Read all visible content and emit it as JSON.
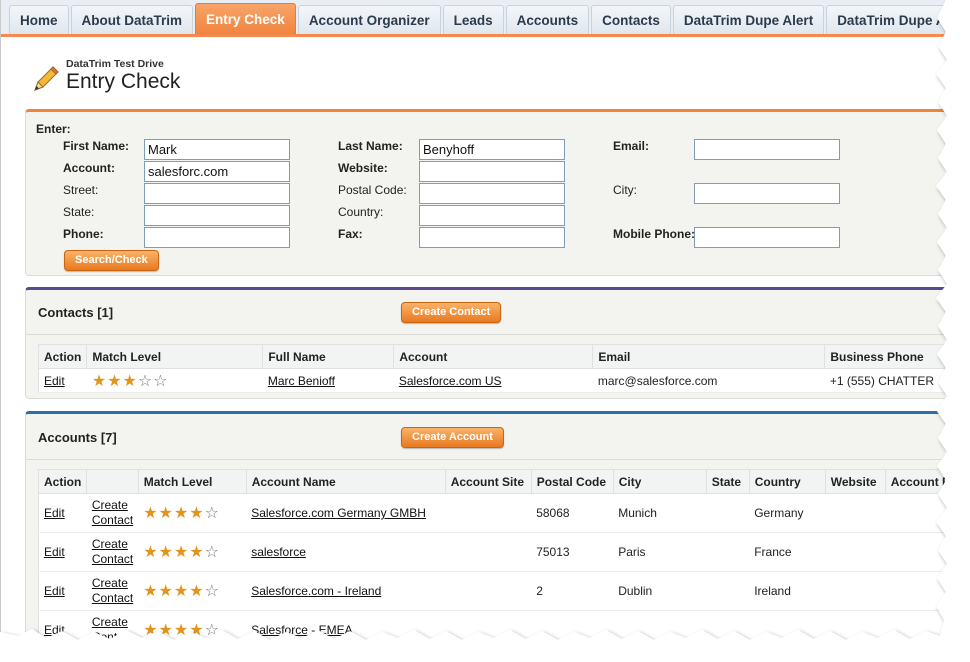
{
  "tabs": [
    {
      "label": "Home",
      "active": false
    },
    {
      "label": "About DataTrim",
      "active": false
    },
    {
      "label": "Entry Check",
      "active": true
    },
    {
      "label": "Account Organizer",
      "active": false
    },
    {
      "label": "Leads",
      "active": false
    },
    {
      "label": "Accounts",
      "active": false
    },
    {
      "label": "Contacts",
      "active": false
    },
    {
      "label": "DataTrim Dupe Alert",
      "active": false
    },
    {
      "label": "DataTrim Dupe Alert Re",
      "active": false
    }
  ],
  "header": {
    "subtitle": "DataTrim Test Drive",
    "title": "Entry Check"
  },
  "entry": {
    "enter_label": "Enter:",
    "first_name_label": "First Name:",
    "first_name_value": "Mark",
    "last_name_label": "Last Name:",
    "last_name_value": "Benyhoff",
    "email_label": "Email:",
    "email_value": "",
    "account_label": "Account:",
    "account_value": "salesforc.com",
    "website_label": "Website:",
    "website_value": "",
    "street_label": "Street:",
    "street_value": "",
    "postal_code_label": "Postal Code:",
    "postal_code_value": "",
    "city_label": "City:",
    "city_value": "",
    "state_label": "State:",
    "state_value": "",
    "country_label": "Country:",
    "country_value": "",
    "phone_label": "Phone:",
    "phone_value": "",
    "fax_label": "Fax:",
    "fax_value": "",
    "mobile_label": "Mobile Phone:",
    "mobile_value": "",
    "search_button": "Search/Check"
  },
  "contacts": {
    "title": "Contacts [1]",
    "create_button": "Create Contact",
    "columns": [
      "Action",
      "Match Level",
      "Full Name",
      "Account",
      "Email",
      "Business Phone"
    ],
    "rows": [
      {
        "action": "Edit",
        "stars": 3,
        "full_name": "Marc Benioff",
        "account": "Salesforce.com US",
        "email": "marc@salesforce.com",
        "phone": "+1 (555) CHATTER"
      }
    ]
  },
  "accounts": {
    "title": "Accounts [7]",
    "create_button": "Create Account",
    "columns": [
      "Action",
      "",
      "Match Level",
      "Account Name",
      "Account Site",
      "Postal Code",
      "City",
      "State",
      "Country",
      "Website",
      "Account R"
    ],
    "create_contact_line1": "Create",
    "create_contact_line2": "Contact",
    "rows": [
      {
        "action": "Edit",
        "stars": 4,
        "name": "Salesforce.com Germany GMBH",
        "site": "",
        "postal": "58068",
        "city": "Munich",
        "state": "",
        "country": "Germany"
      },
      {
        "action": "Edit",
        "stars": 4,
        "name": "salesforce",
        "site": "",
        "postal": "75013",
        "city": "Paris",
        "state": "",
        "country": "France"
      },
      {
        "action": "Edit",
        "stars": 4,
        "name": "Salesforce.com - Ireland",
        "site": "",
        "postal": "2",
        "city": "Dublin",
        "state": "",
        "country": "Ireland"
      },
      {
        "action": "Edit",
        "stars": 4,
        "name": "Salesforce - EMEA",
        "site": "",
        "postal": "",
        "city": "",
        "state": "",
        "country": ""
      }
    ]
  },
  "colors": {
    "accent": "#f0843e",
    "contacts_bar": "#5a4a8a",
    "accounts_bar": "#2e6fa8",
    "star": "#e2941c"
  },
  "icons": {
    "header_icon": "pencil-icon",
    "star_on": "star-filled-icon",
    "star_off": "star-empty-icon"
  }
}
